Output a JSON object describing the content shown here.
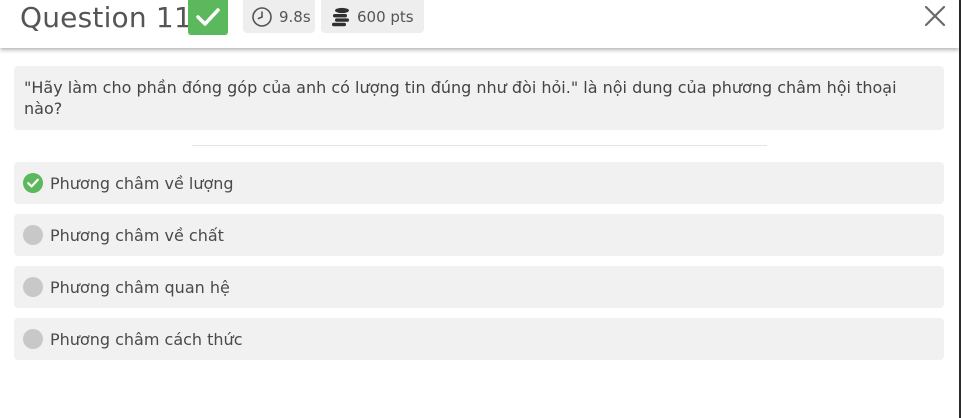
{
  "header": {
    "title": "Question 11",
    "time": "9.8s",
    "points": "600 pts",
    "status_color": "#5cb85c",
    "icons": {
      "status": "checkmark-icon",
      "time": "stopwatch-icon",
      "points": "coin-stack-icon",
      "close": "close-icon"
    }
  },
  "question": {
    "text": "\"Hãy làm cho phần đóng góp của anh có lượng tin đúng như đòi hỏi.\" là nội dung của phương châm hội thoại nào?"
  },
  "options": [
    {
      "label": "Phương châm về lượng",
      "state": "correct",
      "icon": "check-circle-icon"
    },
    {
      "label": "Phương châm về chất",
      "state": "unselected",
      "icon": "grey-circle-icon"
    },
    {
      "label": "Phương châm quan hệ",
      "state": "unselected",
      "icon": "grey-circle-icon"
    },
    {
      "label": "Phương châm cách thức",
      "state": "unselected",
      "icon": "grey-circle-icon"
    }
  ]
}
